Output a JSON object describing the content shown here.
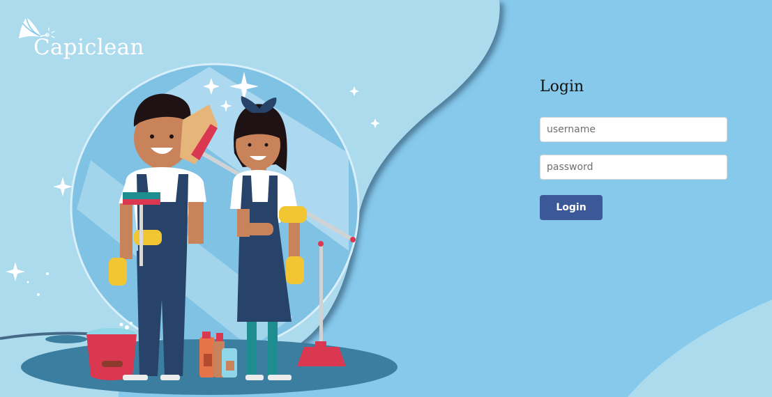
{
  "brand": {
    "name": "Capiclean",
    "logo_icon": "feather-duster-icon"
  },
  "login": {
    "title": "Login",
    "username_placeholder": "username",
    "password_placeholder": "password",
    "submit_label": "Login"
  },
  "colors": {
    "background": "#87c9eb",
    "light_wave": "#aad9ee",
    "button": "#3b5998",
    "field_bg": "#ffffff"
  },
  "illustration": {
    "subject": "cleaners-illustration"
  }
}
